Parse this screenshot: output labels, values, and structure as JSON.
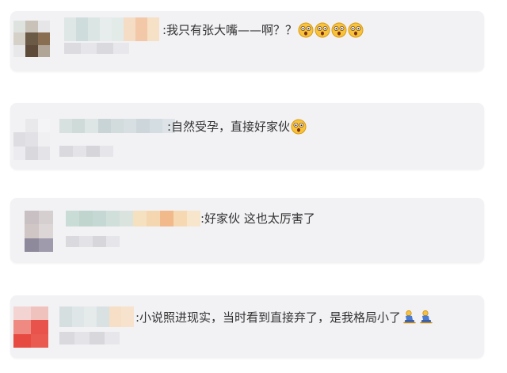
{
  "comments": [
    {
      "text": ":我只有张大嘴——啊？？",
      "emojis": [
        "shocked-face-icon",
        "shocked-face-icon",
        "shocked-face-icon",
        "shocked-face-icon"
      ]
    },
    {
      "text": ":自然受孕，直接好家伙",
      "emojis": [
        "shocked-face-icon"
      ]
    },
    {
      "text": ":好家伙 这也太厉害了",
      "emojis": []
    },
    {
      "text": ":小说照进现实，当时看到直接弃了，是我格局小了",
      "emojis": [
        "kneeling-person-icon",
        "kneeling-person-icon"
      ]
    }
  ],
  "colors": {
    "card_bg": "#f2f2f5",
    "text": "#333333",
    "emoji_face": "#f8c33a"
  }
}
